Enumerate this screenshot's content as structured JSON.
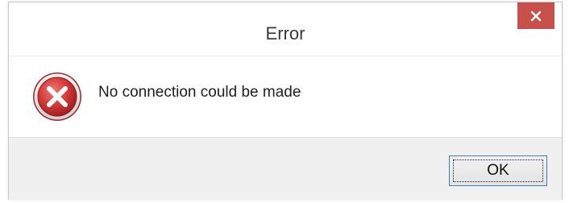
{
  "dialog": {
    "title": "Error",
    "message": "No connection could be made",
    "icon": "error-icon",
    "close_icon": "close-icon",
    "ok_label": "OK"
  },
  "colors": {
    "close_button": "#c7504a",
    "error_icon_red": "#d43b3b",
    "button_border": "#3c7fb1",
    "footer_bg": "#f0f0f0"
  }
}
